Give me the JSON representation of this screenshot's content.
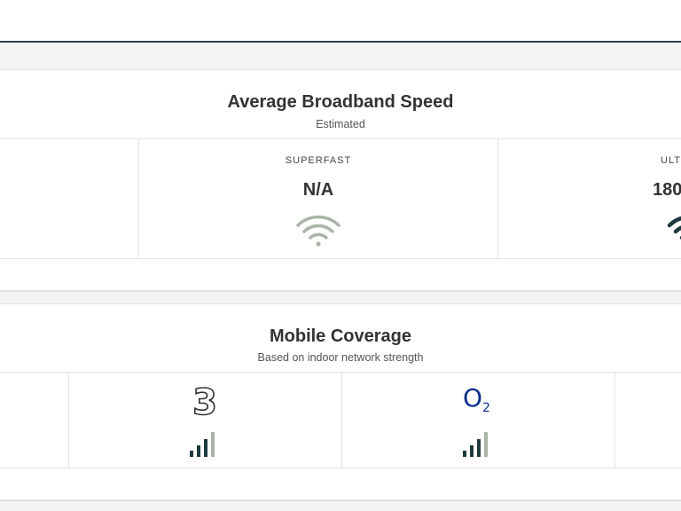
{
  "broadband": {
    "title": "Average Broadband Speed",
    "subtitle": "Estimated",
    "tiers": [
      {
        "label": "SUPERFAST",
        "value": "N/A",
        "icon": "wifi-icon",
        "icon_color": "#aab5a8"
      },
      {
        "label": "ULT",
        "value": "180",
        "icon": "wifi-icon",
        "icon_color": "#1e3a3f"
      }
    ]
  },
  "mobile": {
    "title": "Mobile Coverage",
    "subtitle": "Based on indoor network strength",
    "networks": [
      {
        "logo": "three-logo",
        "logo_text": "3",
        "signal_bars": 3,
        "signal_max": 4
      },
      {
        "logo": "o2-logo",
        "logo_text": "O",
        "logo_sub": "2",
        "signal_bars": 3,
        "signal_max": 4
      }
    ]
  },
  "colors": {
    "header_border": "#2f3b45",
    "signal_strong": "#1e3a3f",
    "signal_weak": "#aab5a8",
    "o2_blue": "#0b2e8a"
  }
}
